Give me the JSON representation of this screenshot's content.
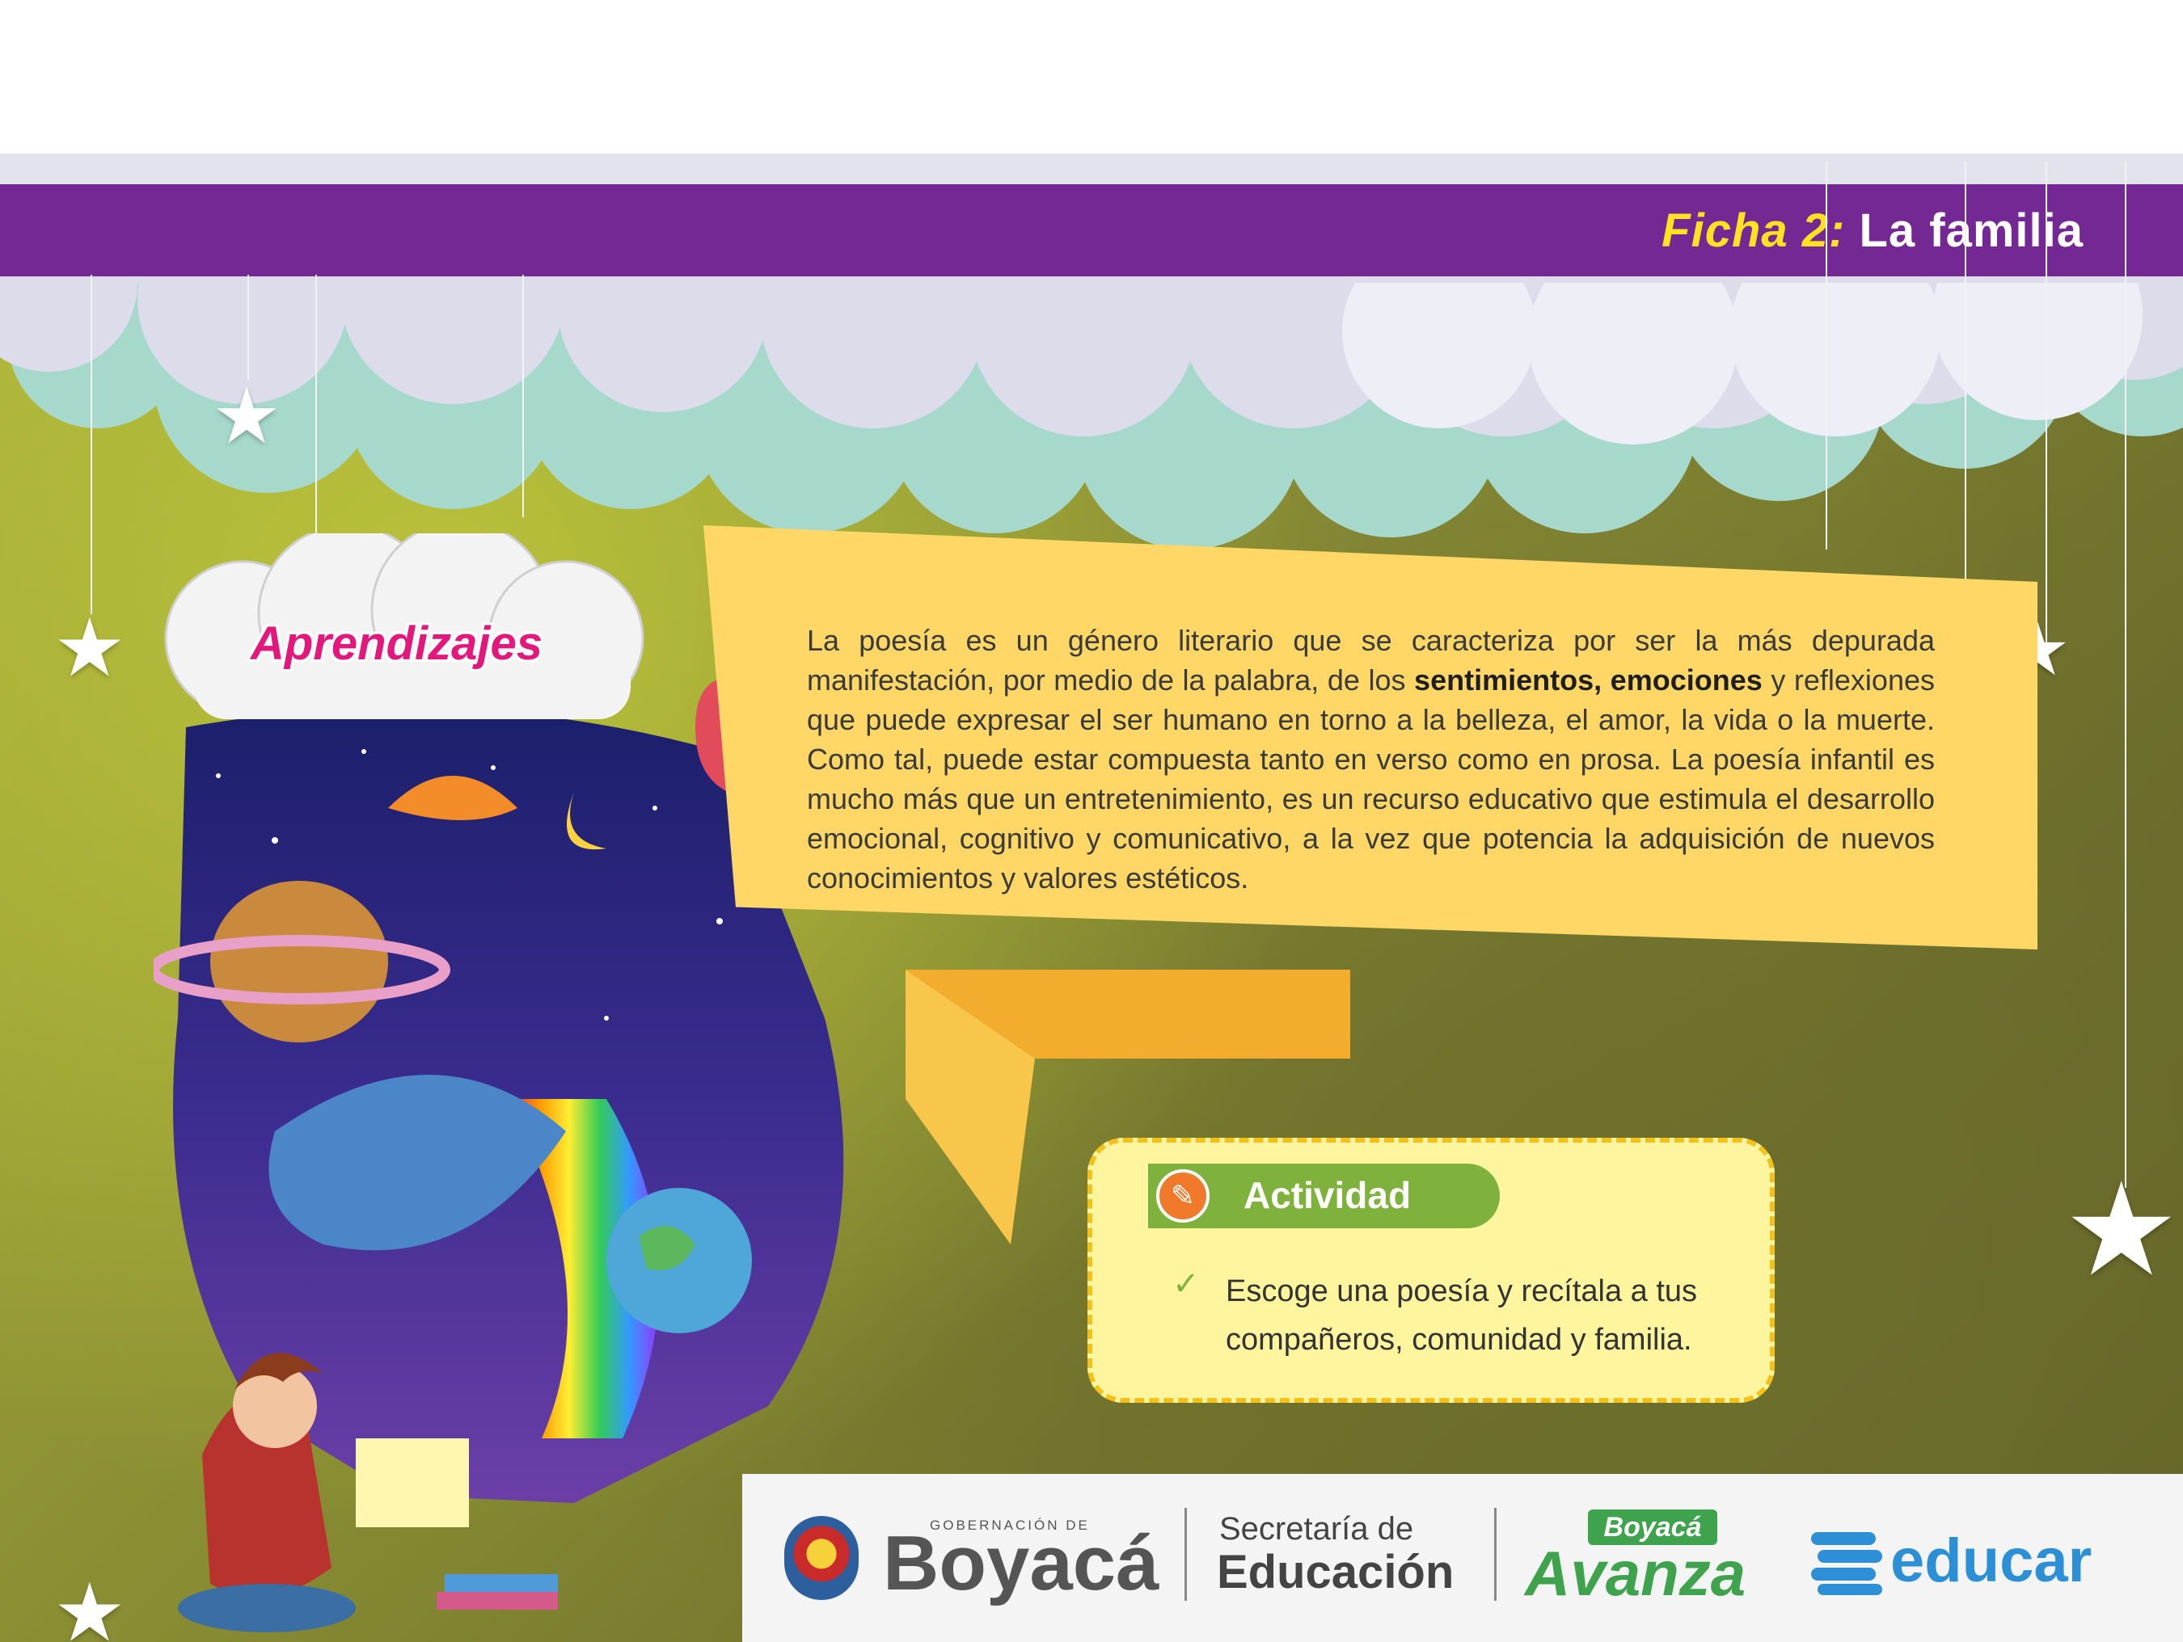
{
  "header": {
    "ficha_label": "Ficha 2:",
    "ficha_title": "La familia"
  },
  "aprendizajes": {
    "title": "Aprendizajes",
    "text_before_bold": "La poesía es un género literario que se caracteriza por ser la más depurada manifestación, por medio de la palabra, de los ",
    "text_bold": "sentimientos, emociones",
    "text_after_bold": " y reflexiones que puede expresar el ser humano en torno a la belleza, el amor, la vida o la muerte. Como tal, puede estar compuesta tanto en verso como en prosa. La poesía infantil es mucho más que un entretenimiento, es un recurso educativo que estimula el desarrollo emocional, cognitivo y comunicativo, a la vez que potencia la adquisición de nuevos conocimientos y valores estéticos."
  },
  "actividad": {
    "title": "Actividad",
    "item": "Escoge una poesía y recítala a tus compañeros, comunidad y familia."
  },
  "footer": {
    "gobernacion_small": "GOBERNACIÓN DE",
    "gobernacion_big": "Boyacá",
    "secretaria_line1": "Secretaría de",
    "secretaria_line2": "Educación",
    "avanza_top": "Boyacá",
    "avanza_big": "Avanza",
    "educar": "educar"
  },
  "colors": {
    "purple_bar": "#732894",
    "ficha_yellow": "#ffe320",
    "info_box": "#ffd766",
    "aprendizajes_pink": "#e4187c",
    "actividad_green": "#7fb23c",
    "actividad_box": "#fff59f"
  },
  "icons": [
    "star-icon",
    "pencil-icon",
    "check-icon",
    "coat-of-arms-icon",
    "educar-logo-icon"
  ]
}
